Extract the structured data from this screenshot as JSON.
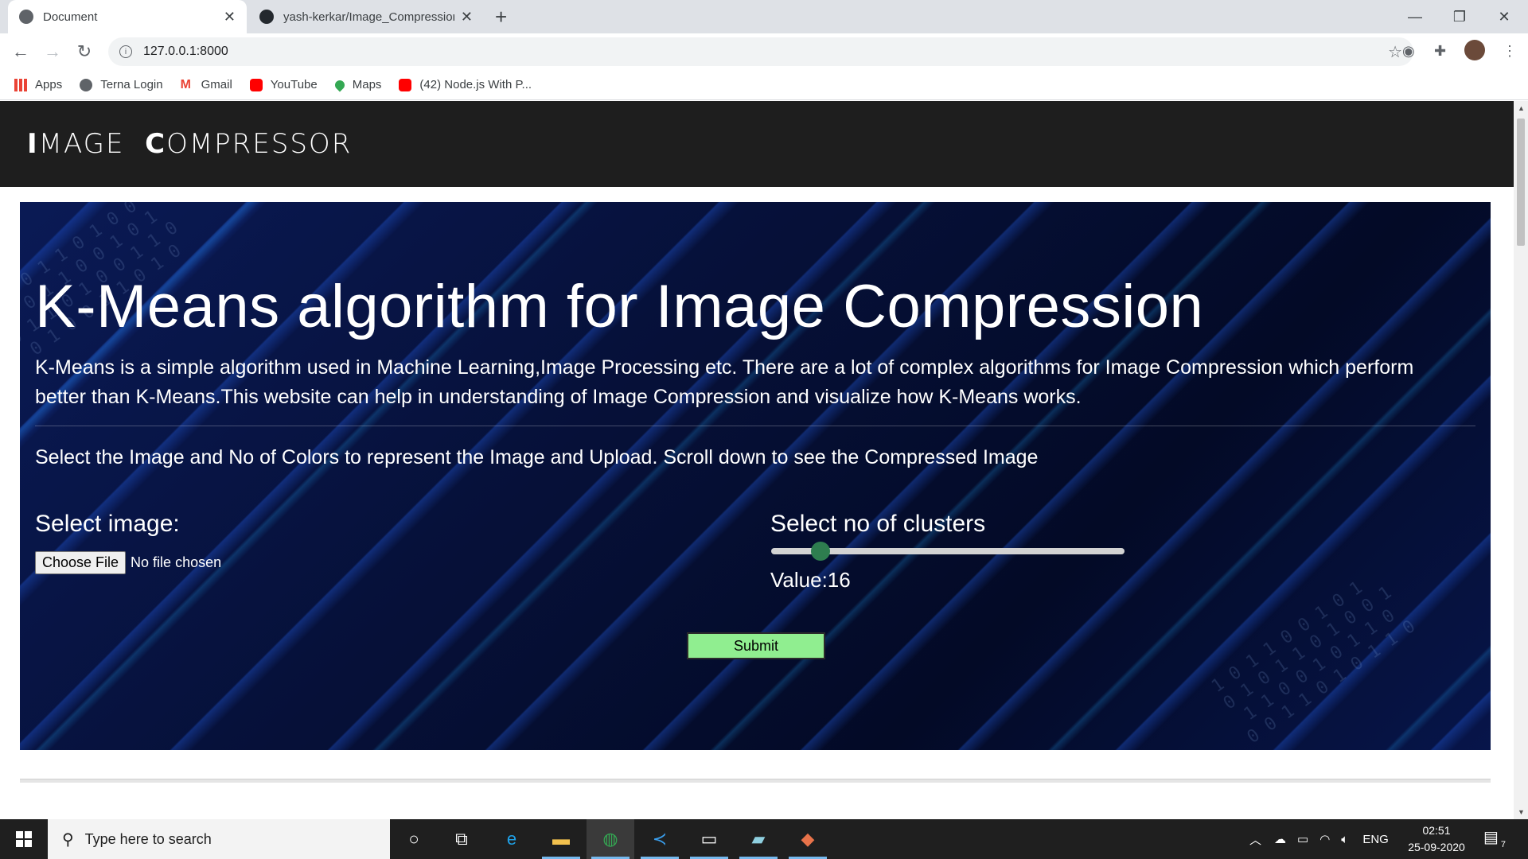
{
  "browser": {
    "tabs": [
      {
        "title": "Document",
        "active": true
      },
      {
        "title": "yash-kerkar/Image_Compression",
        "active": false
      }
    ],
    "url": "127.0.0.1:8000",
    "bookmarks": [
      {
        "label": "Apps",
        "icon": "apps-grid-icon"
      },
      {
        "label": "Terna Login",
        "icon": "globe-icon"
      },
      {
        "label": "Gmail",
        "icon": "gmail-icon"
      },
      {
        "label": "YouTube",
        "icon": "youtube-icon"
      },
      {
        "label": "Maps",
        "icon": "maps-pin-icon"
      },
      {
        "label": "(42) Node.js With P...",
        "icon": "youtube-icon"
      }
    ]
  },
  "site": {
    "brand_first_cap": "I",
    "brand_first_rest": "MAGE",
    "brand_second_cap": "C",
    "brand_second_rest": "OMPRESSOR"
  },
  "hero": {
    "heading": "K-Means algorithm for Image Compression",
    "description": "K-Means is a simple algorithm used in Machine Learning,Image Processing etc. There are a lot of complex algorithms for Image Compression which perform better than K-Means.This website can help in understanding of Image Compression and visualize how K-Means works.",
    "instruction": "Select the Image and No of Colors to represent the Image and Upload. Scroll down to see the Compressed Image",
    "select_image_label": "Select image:",
    "choose_file_label": "Choose File",
    "no_file_text": "No file chosen",
    "clusters_label": "Select no of clusters",
    "slider_fraction": 0.12,
    "value_text": "Value:16",
    "submit_label": "Submit"
  },
  "taskbar": {
    "search_placeholder": "Type here to search",
    "language": "ENG",
    "time": "02:51",
    "date": "25-09-2020",
    "notification_count": "7"
  },
  "colors": {
    "header_bg": "#1e1e1e",
    "submit_bg": "#90ee90",
    "slider_knob": "#2e7d4f"
  }
}
